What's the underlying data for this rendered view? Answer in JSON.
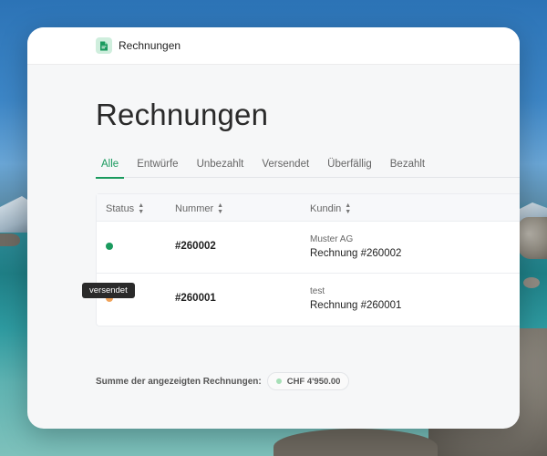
{
  "app": {
    "title": "Rechnungen"
  },
  "page": {
    "title": "Rechnungen"
  },
  "tabs": [
    {
      "label": "Alle",
      "active": true
    },
    {
      "label": "Entwürfe",
      "active": false
    },
    {
      "label": "Unbezahlt",
      "active": false
    },
    {
      "label": "Versendet",
      "active": false
    },
    {
      "label": "Überfällig",
      "active": false
    },
    {
      "label": "Bezahlt",
      "active": false
    }
  ],
  "table": {
    "headers": {
      "status": "Status",
      "number": "Nummer",
      "customer": "Kundin"
    },
    "rows": [
      {
        "status_color": "#1a9a5e",
        "number": "#260002",
        "customer": "Muster AG",
        "invoice": "Rechnung #260002"
      },
      {
        "status_color": "#f0a35a",
        "number": "#260001",
        "customer": "test",
        "invoice": "Rechnung #260001"
      }
    ]
  },
  "tooltip": {
    "text": "versendet"
  },
  "summary": {
    "label": "Summe der angezeigten Rechnungen:",
    "amount": "CHF 4'950.00"
  },
  "colors": {
    "accent": "#1a9a5e",
    "paid": "#1a9a5e",
    "sent": "#f0a35a"
  },
  "icons": {
    "app": "document-icon",
    "sort": "sort-icon"
  }
}
